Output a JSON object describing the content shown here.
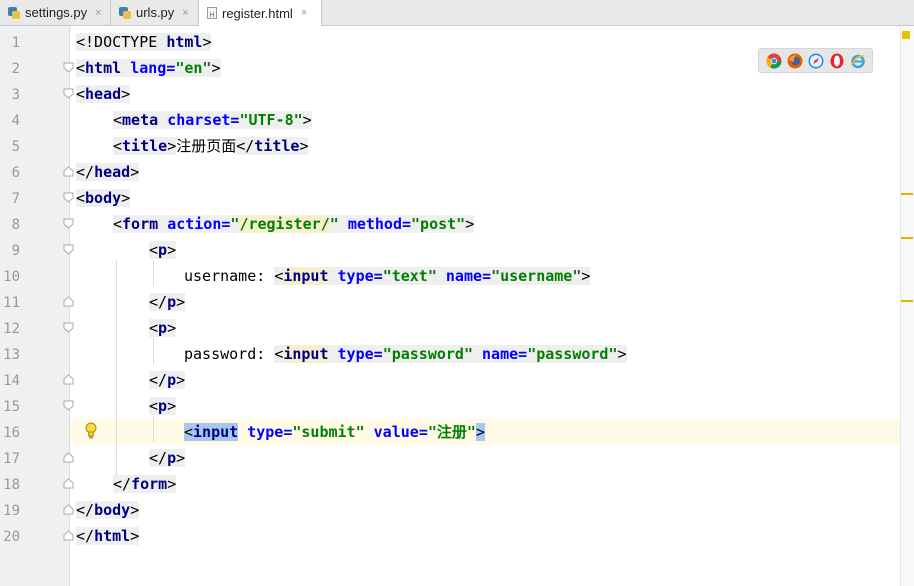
{
  "tabs": [
    {
      "label": "settings.py",
      "icon": "python-file-icon",
      "active": false
    },
    {
      "label": "urls.py",
      "icon": "python-file-icon",
      "active": false
    },
    {
      "label": "register.html",
      "icon": "html-file-icon",
      "active": true
    }
  ],
  "close_glyph": "×",
  "line_numbers": [
    "1",
    "2",
    "3",
    "4",
    "5",
    "6",
    "7",
    "8",
    "9",
    "10",
    "11",
    "12",
    "13",
    "14",
    "15",
    "16",
    "17",
    "18",
    "19",
    "20"
  ],
  "code": {
    "l1": {
      "lt": "<",
      "doctype": "!DOCTYPE",
      "kw": "html",
      "gt": ">"
    },
    "l2": {
      "lt": "<",
      "tag": "html",
      "attr": "lang",
      "eq": "=",
      "val": "\"en\"",
      "gt": ">"
    },
    "l3": {
      "lt": "<",
      "tag": "head",
      "gt": ">"
    },
    "l4": {
      "lt": "<",
      "tag": "meta",
      "attr": "charset",
      "eq": "=",
      "val": "\"UTF-8\"",
      "gt": ">"
    },
    "l5": {
      "lt": "<",
      "tag": "title",
      "gt": ">",
      "text": "注册页面",
      "close_lt": "</",
      "close_tag": "title",
      "close_gt": ">"
    },
    "l6": {
      "lt": "</",
      "tag": "head",
      "gt": ">"
    },
    "l7": {
      "lt": "<",
      "tag": "body",
      "gt": ">"
    },
    "l8": {
      "lt": "<",
      "tag": "form",
      "attr1": "action",
      "eq": "=",
      "q": "\"",
      "val1_path": "/register/",
      "attr2": "method",
      "val2": "\"post\"",
      "gt": ">"
    },
    "l9": {
      "lt": "<",
      "tag": "p",
      "gt": ">"
    },
    "l10": {
      "text": "username: ",
      "lt": "<",
      "tag": "input",
      "attr1": "type",
      "eq": "=",
      "val1": "\"text\"",
      "attr2": "name",
      "val2": "\"username\"",
      "gt": ">"
    },
    "l11": {
      "lt": "</",
      "tag": "p",
      "gt": ">"
    },
    "l12": {
      "lt": "<",
      "tag": "p",
      "gt": ">"
    },
    "l13": {
      "text": "password: ",
      "lt": "<",
      "tag": "input",
      "attr1": "type",
      "eq": "=",
      "val1": "\"password\"",
      "attr2": "name",
      "val2": "\"password\"",
      "gt": ">"
    },
    "l14": {
      "lt": "</",
      "tag": "p",
      "gt": ">"
    },
    "l15": {
      "lt": "<",
      "tag": "p",
      "gt": ">"
    },
    "l16": {
      "lt": "<",
      "tag": "input",
      "attr1": "type",
      "eq": "=",
      "val1": "\"submit\"",
      "attr2": "value",
      "val2": "\"注册\"",
      "gt": ">"
    },
    "l17": {
      "lt": "</",
      "tag": "p",
      "gt": ">"
    },
    "l18": {
      "lt": "</",
      "tag": "form",
      "gt": ">"
    },
    "l19": {
      "lt": "</",
      "tag": "body",
      "gt": ">"
    },
    "l20": {
      "lt": "</",
      "tag": "html",
      "gt": ">"
    }
  },
  "browser_icons": [
    {
      "name": "chrome-icon",
      "color": "#dd4b39"
    },
    {
      "name": "firefox-icon",
      "color": "#e66000"
    },
    {
      "name": "safari-icon",
      "color": "#1e88e5"
    },
    {
      "name": "opera-icon",
      "color": "#e8222d"
    },
    {
      "name": "ie-icon",
      "color": "#3ba5e0"
    }
  ],
  "colors": {
    "tag": "#000080",
    "attr": "#0000ff",
    "value": "#008000",
    "current_line": "#fffbe6",
    "marker": "#e4b400"
  }
}
